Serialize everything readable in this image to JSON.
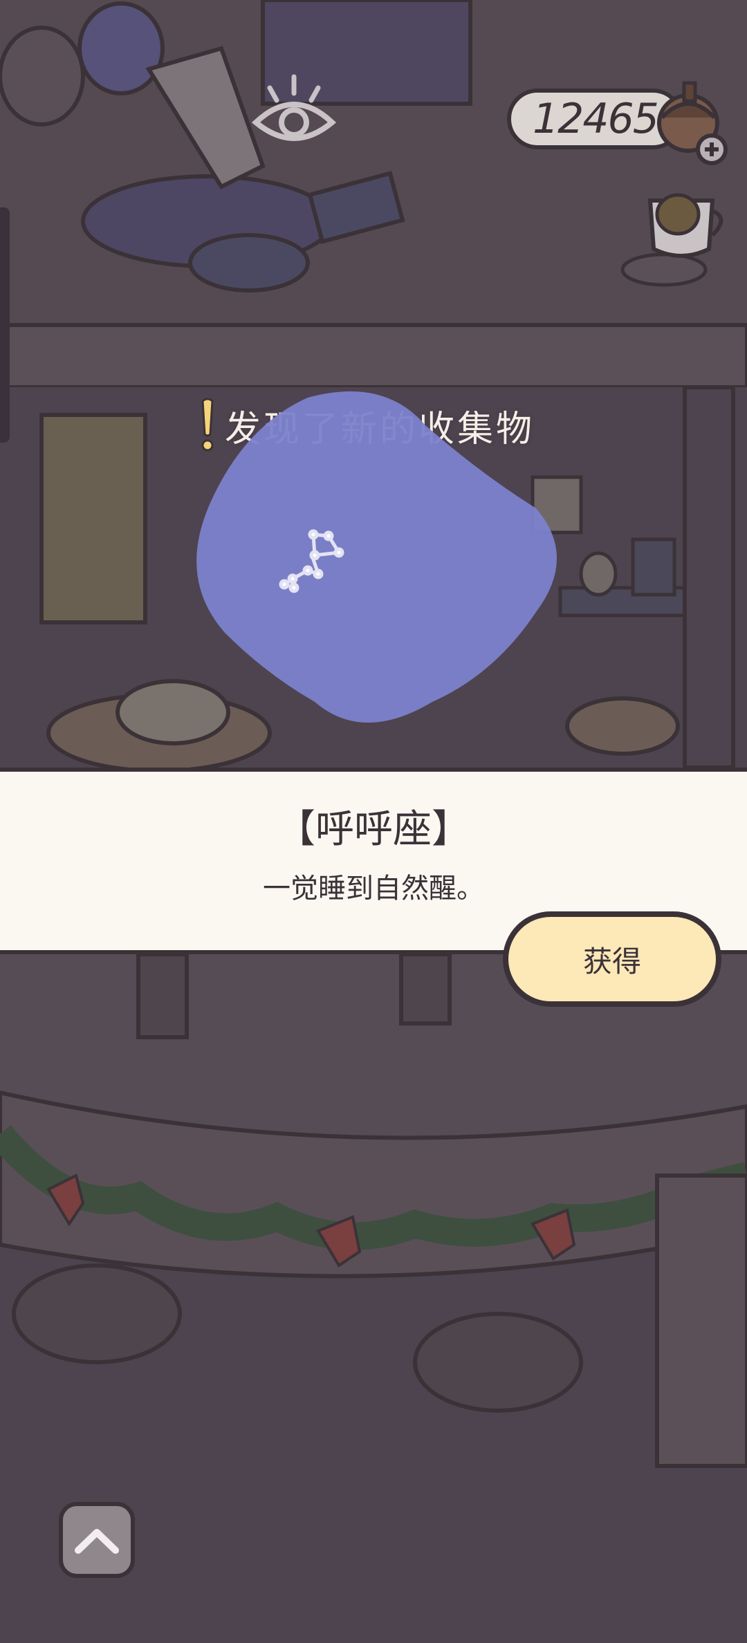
{
  "hud": {
    "coins": "12465",
    "coin_icon": "acorn-coin-plus-icon",
    "teacup_icon": "teacup-icon",
    "eye_icon": "eye-icon"
  },
  "notice": {
    "text": "发现了新的收集物",
    "icon": "exclamation-icon"
  },
  "collectible": {
    "name": "【呼呼座】",
    "description": "一觉睡到自然醒。",
    "icon": "constellation-icon"
  },
  "actions": {
    "obtain_label": "获得",
    "up_icon": "chevron-up-icon"
  },
  "colors": {
    "overlay": "#4e444f",
    "blob": "#7c82cc",
    "panel": "#fbf8f2",
    "button": "#fde8b8",
    "outline": "#3b3238"
  }
}
